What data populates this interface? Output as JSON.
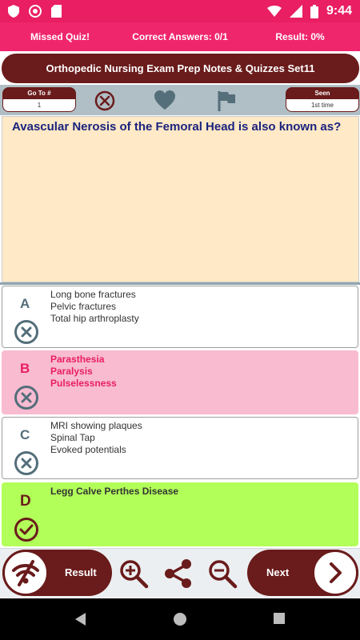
{
  "status_bar": {
    "time": "9:44"
  },
  "stats": {
    "missed": "Missed Quiz!",
    "correct": "Correct Answers: 0/1",
    "result": "Result: 0%"
  },
  "title": "Orthopedic Nursing Exam Prep Notes & Quizzes Set11",
  "toolbar": {
    "goto_label": "Go To #",
    "goto_value": "1",
    "seen_label": "Seen",
    "seen_value": "1st time"
  },
  "question": "Avascular Nerosis of the Femoral Head is also known as?",
  "answers": [
    {
      "letter": "A",
      "lines": [
        "Long bone fractures",
        "Pelvic fractures",
        "Total hip arthroplasty"
      ],
      "state": "wrong"
    },
    {
      "letter": "B",
      "lines": [
        "Parasthesia",
        "Paralysis",
        "Pulselessness"
      ],
      "state": "selected-wrong"
    },
    {
      "letter": "C",
      "lines": [
        "MRI showing plaques",
        "Spinal Tap",
        "Evoked potentials"
      ],
      "state": "wrong"
    },
    {
      "letter": "D",
      "lines": [
        "Legg Calve Perthes Disease"
      ],
      "state": "correct"
    }
  ],
  "actions": {
    "result_label": "Result",
    "next_label": "Next"
  },
  "colors": {
    "accent": "#e91e63",
    "brand": "#6a1b1b",
    "question_bg": "#ffe9c6",
    "selected_bg": "#f8bbd0",
    "correct_bg": "#b2ff59"
  },
  "icons": {
    "status": [
      "shield-icon",
      "circle-icon",
      "sd-card-icon",
      "wifi-icon",
      "signal-icon",
      "battery-icon"
    ],
    "toolbar": [
      "close-circle-icon",
      "heart-icon",
      "flag-icon"
    ],
    "actions": [
      "no-wifi-icon",
      "zoom-in-icon",
      "share-icon",
      "zoom-out-icon",
      "chevron-right-icon"
    ],
    "nav": [
      "back-icon",
      "home-icon",
      "recents-icon"
    ]
  }
}
